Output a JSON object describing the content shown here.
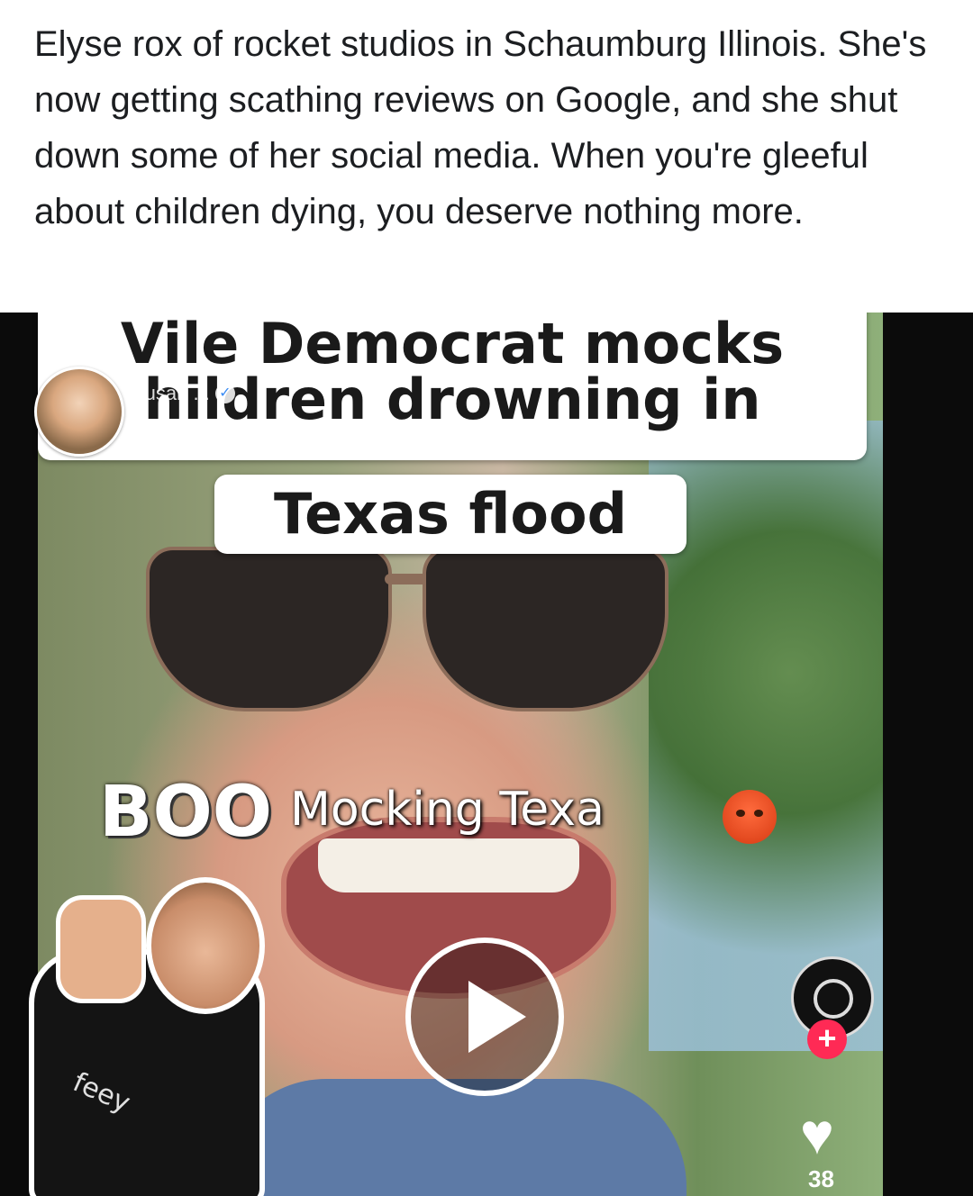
{
  "post": {
    "text": "Elyse rox of rocket studios in Schaumburg Illinois.  She's now getting scathing reviews on Google,  and she shut down some of her social media.  When you're gleeful about children dying, you deserve nothing more."
  },
  "video": {
    "caption_line1": "Vile Democrat mocks",
    "caption_line2": "hildren drowning in",
    "caption_line3": "Texas flood",
    "uploader_name": "Susan ...",
    "overlay_text": "Mocking Texa",
    "boo_text": "BOO",
    "sticker_label": "feey",
    "plus_symbol": "+",
    "heart_symbol": "♥",
    "like_count": "38"
  }
}
